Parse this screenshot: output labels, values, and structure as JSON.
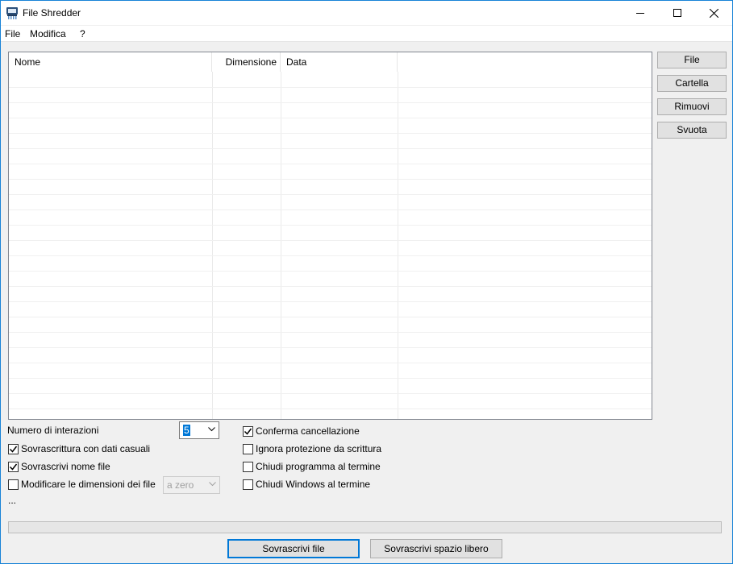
{
  "window": {
    "title": "File Shredder"
  },
  "menu": [
    "File",
    "Modifica",
    "?"
  ],
  "list": {
    "columns": [
      "Nome",
      "Dimensione",
      "Data"
    ],
    "rows": []
  },
  "side_buttons": [
    "File",
    "Cartella",
    "Rimuovi",
    "Svuota"
  ],
  "options": {
    "iterations_label": "Numero di interazioni",
    "iterations_value": "5",
    "overwrite_random": {
      "label": "Sovrascrittura con dati casuali",
      "checked": true
    },
    "overwrite_name": {
      "label": "Sovrascrivi nome file",
      "checked": true
    },
    "modify_size": {
      "label": "Modificare le dimensioni dei file",
      "checked": false
    },
    "size_mode": {
      "value": "a zero",
      "disabled": true
    },
    "ellipsis": "...",
    "confirm_delete": {
      "label": "Conferma cancellazione",
      "checked": true
    },
    "ignore_protection": {
      "label": "Ignora protezione da scrittura",
      "checked": false
    },
    "close_program": {
      "label": "Chiudi programma al termine",
      "checked": false
    },
    "shutdown_windows": {
      "label": "Chiudi Windows al termine",
      "checked": false
    }
  },
  "progress": {
    "value": 0
  },
  "bottom_buttons": {
    "overwrite_files": "Sovrascrivi file",
    "overwrite_free_space": "Sovrascrivi spazio libero"
  }
}
